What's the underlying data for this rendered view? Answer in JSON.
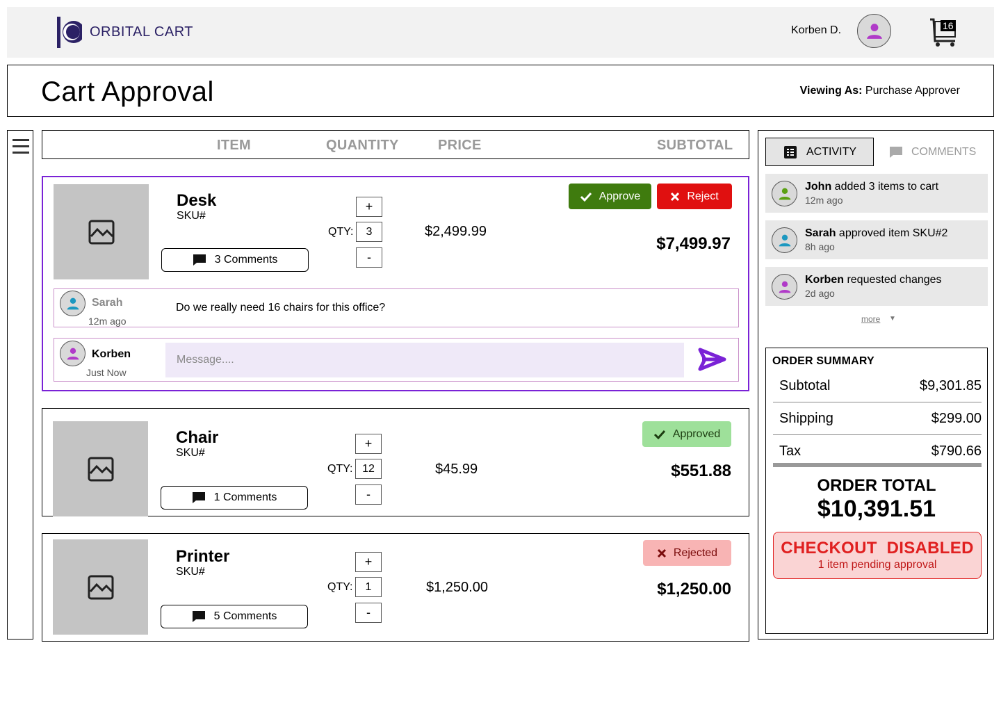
{
  "brand": {
    "name": "ORBITAL CART"
  },
  "user": {
    "name": "Korben D.",
    "cart_count": "16"
  },
  "header": {
    "title": "Cart Approval",
    "viewing_label": "Viewing As:",
    "viewing_role": "Purchase Approver"
  },
  "columns": {
    "item": "ITEM",
    "quantity": "QUANTITY",
    "price": "PRICE",
    "subtotal": "SUBTOTAL"
  },
  "items": [
    {
      "name": "Desk",
      "sku": "SKU#",
      "comments_label": "3 Comments",
      "qty_label": "QTY:",
      "qty": "3",
      "plus": "+",
      "minus": "-",
      "price": "$2,499.99",
      "subtotal": "$7,499.97",
      "approve_label": "Approve",
      "reject_label": "Reject",
      "comment": {
        "author": "Sarah",
        "time": "12m ago",
        "text": "Do we really need 16 chairs for this office?"
      },
      "reply": {
        "author": "Korben",
        "time": "Just Now",
        "placeholder": "Message...."
      }
    },
    {
      "name": "Chair",
      "sku": "SKU#",
      "comments_label": "1 Comments",
      "qty_label": "QTY:",
      "qty": "12",
      "plus": "+",
      "minus": "-",
      "price": "$45.99",
      "subtotal": "$551.88",
      "status": "Approved"
    },
    {
      "name": "Printer",
      "sku": "SKU#",
      "comments_label": "5 Comments",
      "qty_label": "QTY:",
      "qty": "1",
      "plus": "+",
      "minus": "-",
      "price": "$1,250.00",
      "subtotal": "$1,250.00",
      "status": "Rejected"
    }
  ],
  "tabs": {
    "activity": "ACTIVITY",
    "comments": "COMMENTS"
  },
  "activity": [
    {
      "user": "John",
      "action": " added 3 items to cart",
      "time": "12m ago",
      "avatar_color": "#5aa012"
    },
    {
      "user": "Sarah",
      "action": " approved item SKU#2",
      "time": "8h ago",
      "avatar_color": "#1c98c0"
    },
    {
      "user": "Korben",
      "action": " requested changes",
      "time": "2d ago",
      "avatar_color": "#b03ac8"
    }
  ],
  "more_label": "more",
  "summary": {
    "title": "ORDER SUMMARY",
    "subtotal_label": "Subtotal",
    "subtotal": "$9,301.85",
    "shipping_label": "Shipping",
    "shipping": "$299.00",
    "tax_label": "Tax",
    "tax": "$790.66",
    "total_label": "ORDER TOTAL",
    "total": "$10,391.51",
    "checkout_label": "CHECKOUT  DISABLED",
    "checkout_note": "1 item pending approval"
  },
  "colors": {
    "brand": "#2b2165",
    "accent": "#7a22d6",
    "approve": "#3f7b0e",
    "reject": "#e01010"
  },
  "icons": [
    "orbital-logo-icon",
    "user-avatar-icon",
    "cart-icon",
    "hamburger-icon",
    "image-placeholder-icon",
    "comment-icon",
    "check-icon",
    "close-icon",
    "send-icon",
    "list-icon"
  ]
}
